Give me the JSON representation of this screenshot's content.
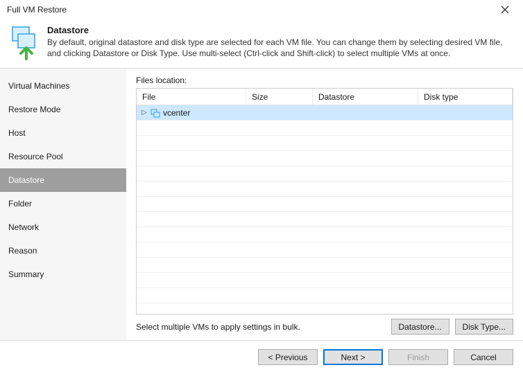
{
  "window": {
    "title": "Full VM Restore"
  },
  "header": {
    "title": "Datastore",
    "description": "By default, original datastore and disk type are selected for each VM file. You can change them by selecting desired VM file, and clicking Datastore or Disk Type. Use multi-select (Ctrl-click and Shift-click) to select multiple VMs at once."
  },
  "sidebar": {
    "items": [
      {
        "label": "Virtual Machines"
      },
      {
        "label": "Restore Mode"
      },
      {
        "label": "Host"
      },
      {
        "label": "Resource Pool"
      },
      {
        "label": "Datastore"
      },
      {
        "label": "Folder"
      },
      {
        "label": "Network"
      },
      {
        "label": "Reason"
      },
      {
        "label": "Summary"
      }
    ],
    "active_index": 4
  },
  "main": {
    "files_label": "Files location:",
    "columns": {
      "file": "File",
      "size": "Size",
      "datastore": "Datastore",
      "disk_type": "Disk type"
    },
    "rows": [
      {
        "file": "vcenter",
        "size": "",
        "datastore": "",
        "disk_type": "",
        "selected": true,
        "expandable": true
      }
    ],
    "hint": "Select multiple VMs to apply settings in bulk.",
    "datastore_btn": "Datastore...",
    "disktype_btn": "Disk Type..."
  },
  "footer": {
    "previous": "< Previous",
    "next": "Next >",
    "finish": "Finish",
    "cancel": "Cancel"
  }
}
